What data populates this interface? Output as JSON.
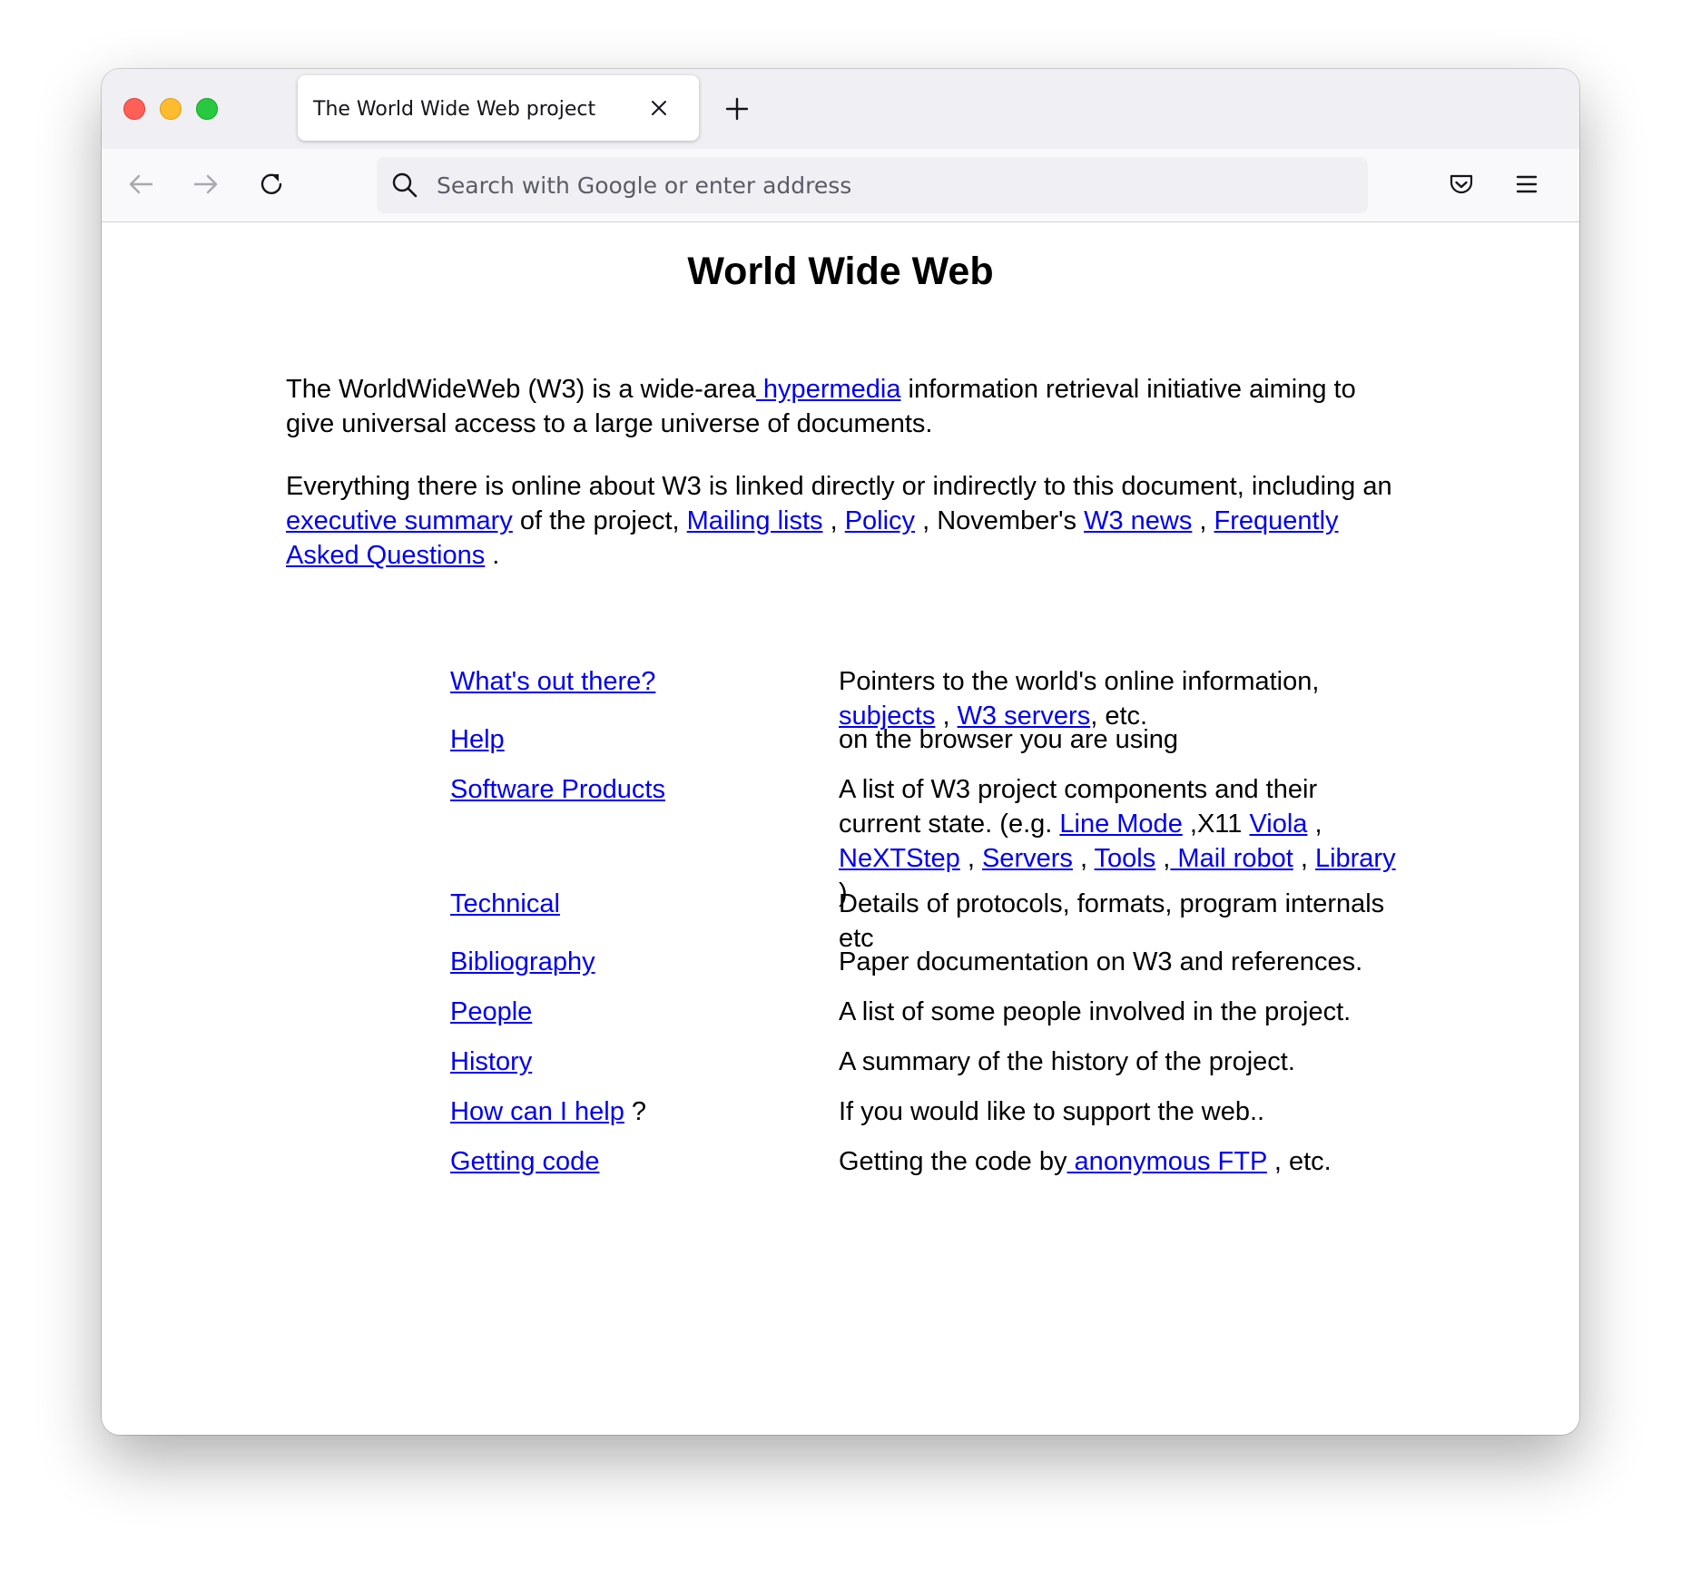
{
  "browser": {
    "tab_title": "The World Wide Web project",
    "url_placeholder": "Search with Google or enter address"
  },
  "page": {
    "heading": "World Wide Web",
    "intro": {
      "t1": "The WorldWideWeb (W3) is a wide-area",
      "link_hypermedia": " hypermedia",
      "t2": " information retrieval initiative aiming to give universal access to a large universe of documents."
    },
    "everything": {
      "t1": "Everything there is online about W3 is linked directly or indirectly to this document, including an ",
      "link_exec": "executive summary",
      "t2": " of the project, ",
      "link_mailing": "Mailing lists",
      "t3": " , ",
      "link_policy": "Policy",
      "t4": " , November's ",
      "link_news": "W3 news",
      "t5": " , ",
      "link_faq": "Frequently Asked Questions",
      "t6": " ."
    },
    "items": {
      "whats_out": {
        "term": "What's out there?",
        "desc": "Pointers to the world's online information, ",
        "link_subjects": "subjects",
        "sep1": " , ",
        "link_servers": "W3 servers",
        "end": ", etc."
      },
      "help": {
        "term": "Help",
        "desc": "on the browser you are using"
      },
      "software": {
        "term": "Software Products",
        "desc": "A list of W3 project components and their current state. (e.g. ",
        "link_linemode": "Line Mode",
        "sep1": " ,X11 ",
        "link_viola": "Viola",
        "sep2": " , ",
        "link_nextstep": "NeXTStep",
        "sep3": " , ",
        "link_servers": "Servers",
        "sep4": " , ",
        "link_tools": "Tools",
        "sep5": " ,",
        "link_mailrobot": " Mail robot",
        "sep6": " , ",
        "link_library": "Library",
        "end": " )"
      },
      "technical": {
        "term": "Technical",
        "desc": "Details of protocols, formats, program internals etc"
      },
      "bibliography": {
        "term": "Bibliography",
        "desc": "Paper documentation on W3 and references."
      },
      "people": {
        "term": "People",
        "desc": "A list of some people involved in the project."
      },
      "history": {
        "term": "History",
        "desc": "A summary of the history of the project."
      },
      "how_help": {
        "term": "How can I help",
        "suffix": " ?",
        "desc": "If you would like to support the web.."
      },
      "getting_code": {
        "term": "Getting code",
        "desc": "Getting the code by",
        "link_ftp": " anonymous FTP",
        "end": " , etc."
      }
    }
  },
  "colors": {
    "link": "#0000ee",
    "tabbar_bg": "#f0f0f4",
    "toolbar_bg": "#f9f9fb",
    "close_button": "#fe5f57",
    "minimize_button": "#febc2e",
    "zoom_button": "#28c840"
  },
  "icons": {
    "tab_close": "close-icon",
    "new_tab": "plus-icon",
    "back": "arrow-left-icon",
    "forward": "arrow-right-icon",
    "reload": "reload-icon",
    "search": "search-icon",
    "pocket": "pocket-icon",
    "menu": "hamburger-menu-icon"
  }
}
